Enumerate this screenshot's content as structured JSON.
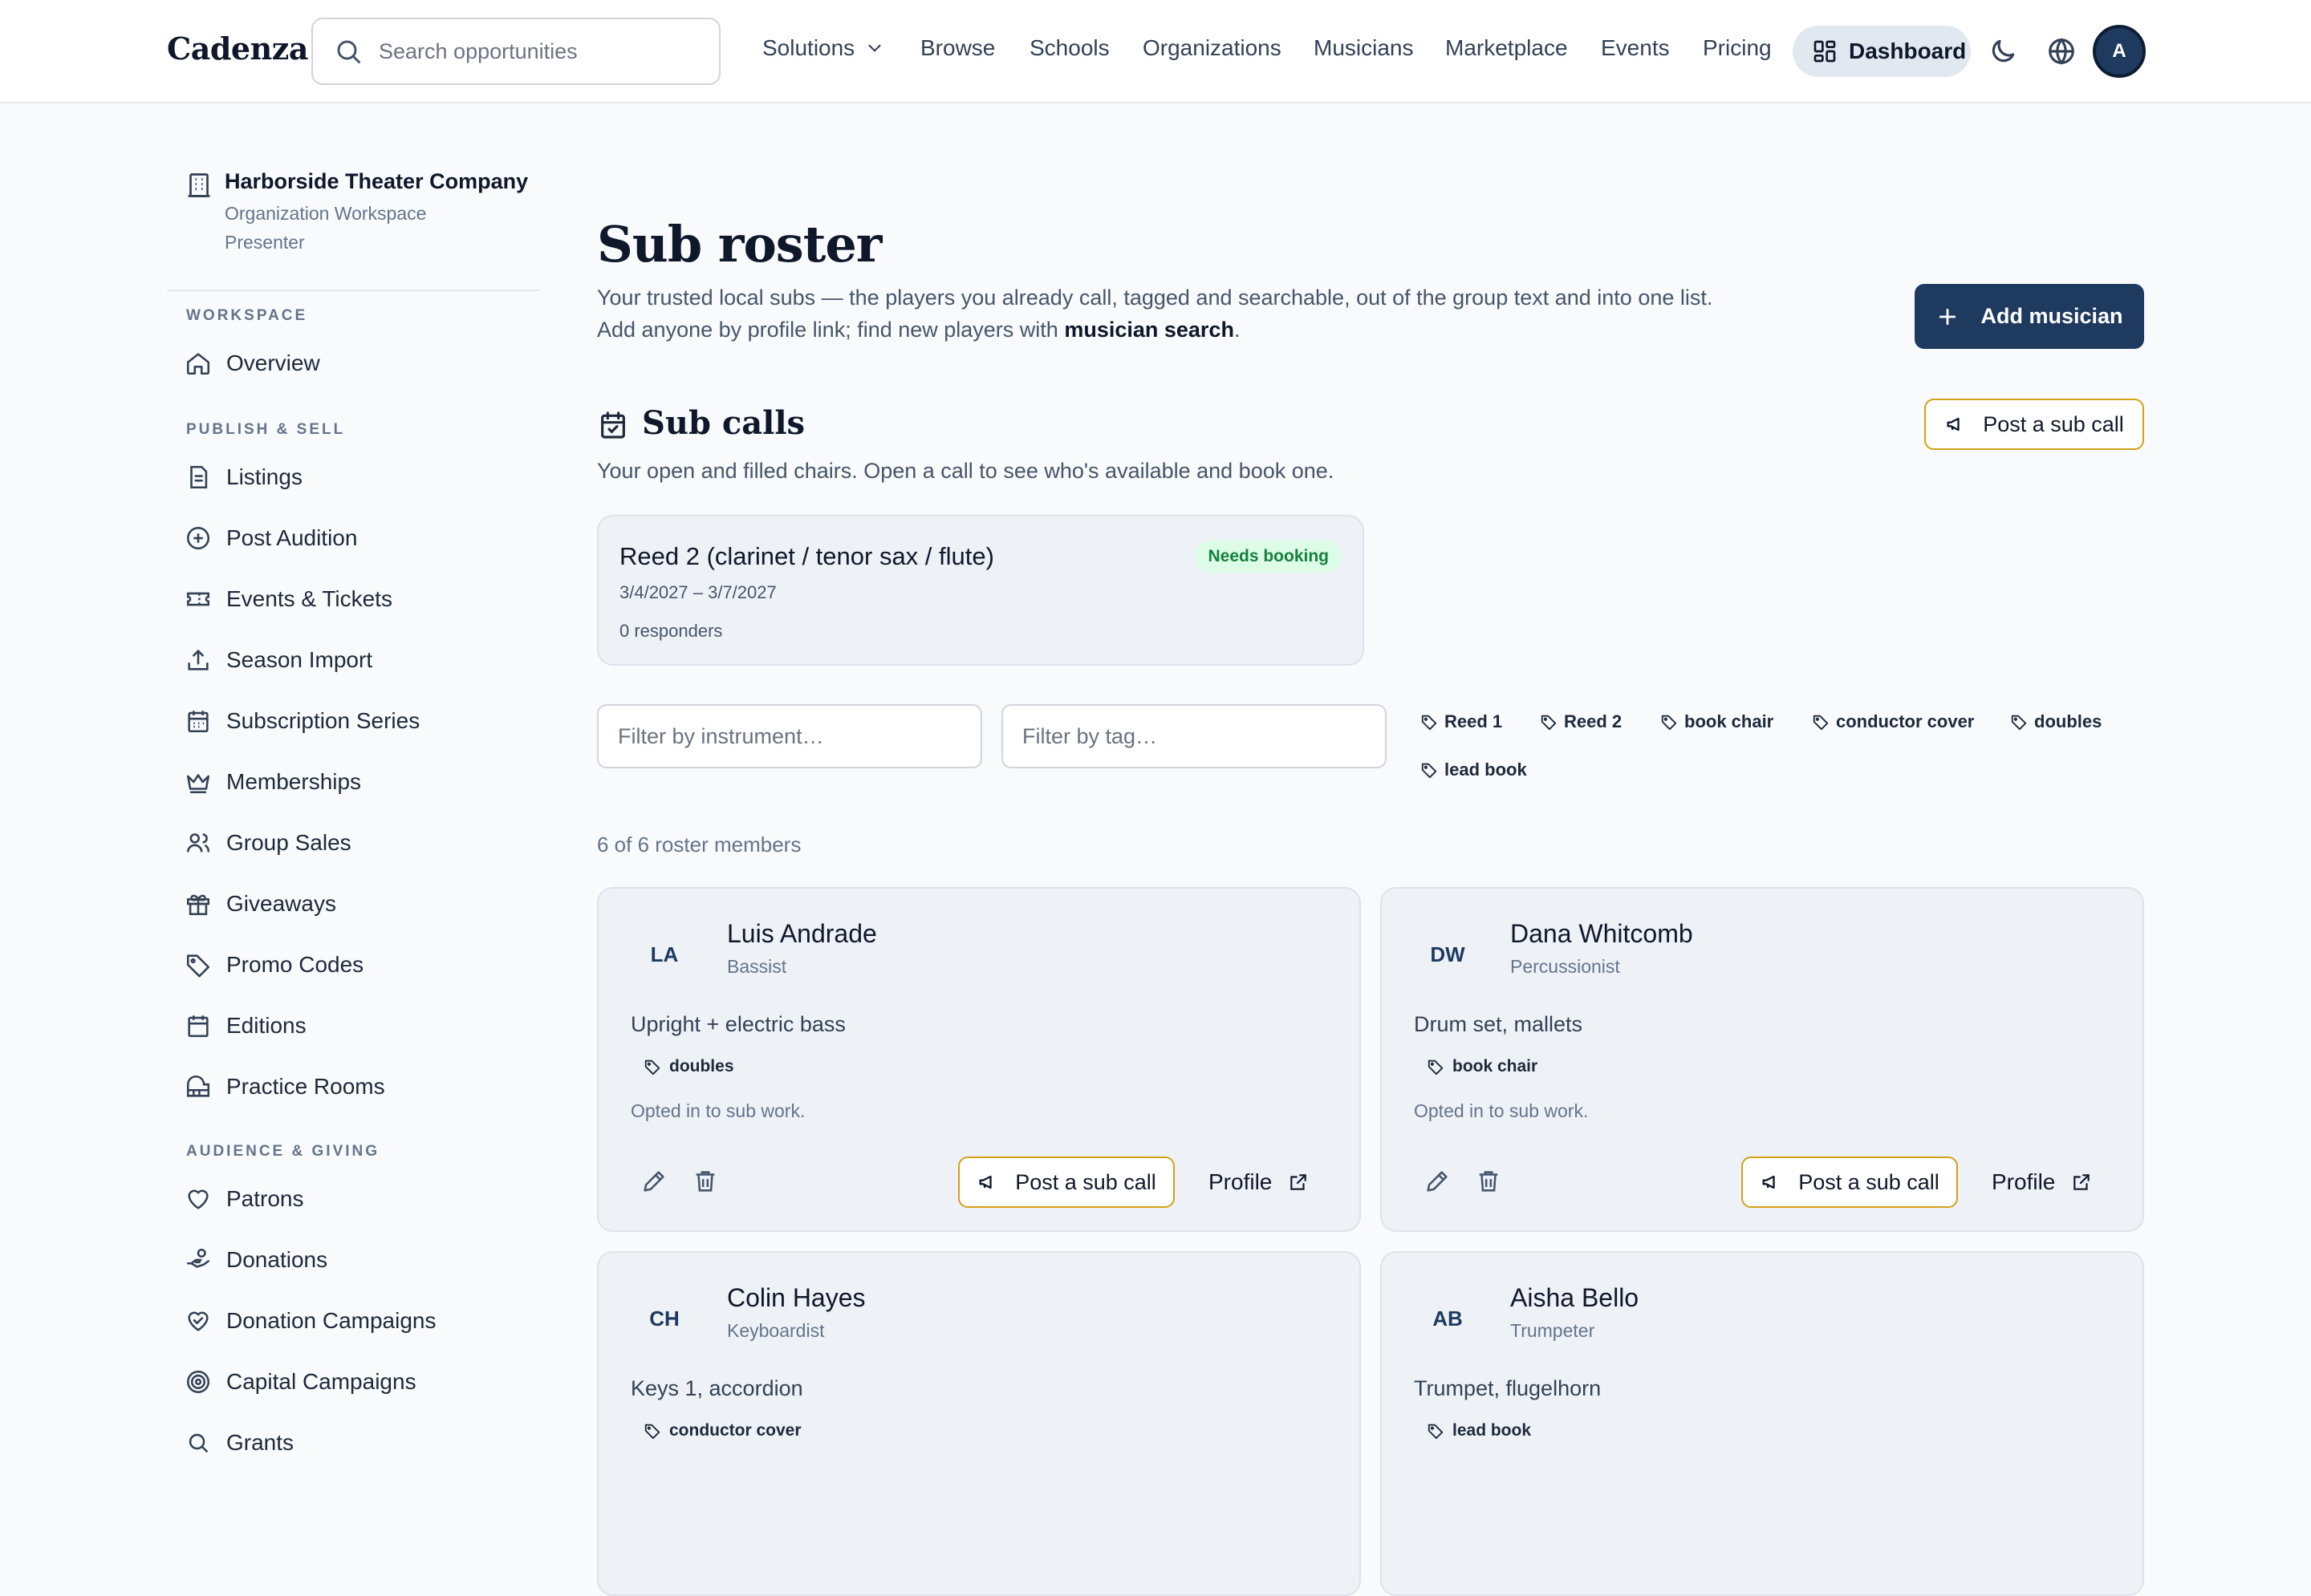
{
  "app": {
    "brand": "Cadenza"
  },
  "nav": {
    "search_placeholder": "Search opportunities",
    "links": [
      "Solutions",
      "Browse",
      "Schools",
      "Organizations",
      "Musicians",
      "Marketplace",
      "Events",
      "Pricing"
    ],
    "dashboard_label": "Dashboard",
    "avatar_initial": "A"
  },
  "sidebar": {
    "org_name": "Harborside Theater Company",
    "org_type": "Organization Workspace",
    "org_role": "Presenter",
    "sections": {
      "workspace": "WORKSPACE",
      "publish": "PUBLISH & SELL",
      "audience": "AUDIENCE & GIVING"
    },
    "items": {
      "overview": "Overview",
      "listings": "Listings",
      "post_audition": "Post Audition",
      "events_tickets": "Events & Tickets",
      "season_import": "Season Import",
      "subscription_series": "Subscription Series",
      "memberships": "Memberships",
      "group_sales": "Group Sales",
      "giveaways": "Giveaways",
      "promo_codes": "Promo Codes",
      "editions": "Editions",
      "practice_rooms": "Practice Rooms",
      "patrons": "Patrons",
      "donations": "Donations",
      "donation_campaigns": "Donation Campaigns",
      "capital_campaigns": "Capital Campaigns",
      "grants": "Grants"
    }
  },
  "main": {
    "title": "Sub roster",
    "lead_line1": "Your trusted local subs — the players you already call, tagged and searchable, out of the group text and into one list.",
    "lead_line2_pre": "Add anyone by profile link; find new players with ",
    "lead_line2_link": "musician search",
    "lead_line2_post": ".",
    "add_button": "Add musician",
    "subcalls": {
      "title": "Sub calls",
      "subtitle": "Your open and filled chairs. Open a call to see who's available and book one.",
      "post_button": "Post a sub call",
      "card": {
        "title": "Reed 2 (clarinet / tenor sax / flute)",
        "status": "Needs booking",
        "dates": "3/4/2027 – 3/7/2027",
        "responders": "0 responders"
      }
    },
    "filters": {
      "instrument_placeholder": "Filter by instrument…",
      "tag_placeholder": "Filter by tag…",
      "tags": [
        "Reed 1",
        "Reed 2",
        "book chair",
        "conductor cover",
        "doubles",
        "lead book"
      ]
    },
    "count_text": "6 of 6 roster members",
    "members": [
      {
        "initials": "LA",
        "name": "Luis Andrade",
        "role": "Bassist",
        "note": "Upright + electric bass",
        "tag": "doubles",
        "optin": "Opted in to sub work.",
        "post_label": "Post a sub call",
        "profile_label": "Profile"
      },
      {
        "initials": "DW",
        "name": "Dana Whitcomb",
        "role": "Percussionist",
        "note": "Drum set, mallets",
        "tag": "book chair",
        "optin": "Opted in to sub work.",
        "post_label": "Post a sub call",
        "profile_label": "Profile"
      },
      {
        "initials": "CH",
        "name": "Colin Hayes",
        "role": "Keyboardist",
        "note": "Keys 1, accordion",
        "tag": "conductor cover"
      },
      {
        "initials": "AB",
        "name": "Aisha Bello",
        "role": "Trumpeter",
        "note": "Trumpet, flugelhorn",
        "tag": "lead book"
      }
    ]
  },
  "colors": {
    "primary": "#1e3a5f",
    "accent_outline": "#d4a017",
    "badge_green": "#15803d",
    "page_bg": "#f8fafc"
  }
}
